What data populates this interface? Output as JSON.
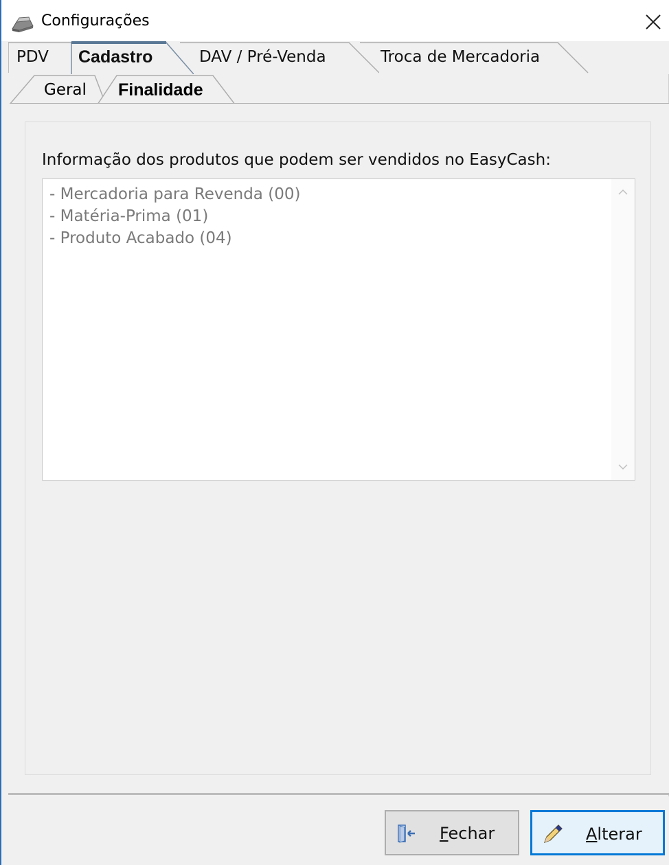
{
  "window": {
    "title": "Configurações",
    "title_icon": "cash-register-icon",
    "close_icon": "close-icon"
  },
  "tabs": [
    {
      "label": "PDV",
      "active": false
    },
    {
      "label": "Cadastro",
      "active": true
    },
    {
      "label": "DAV / Pré-Venda",
      "active": false
    },
    {
      "label": "Troca de Mercadoria",
      "active": false
    }
  ],
  "subtabs": [
    {
      "label": "Geral",
      "active": false
    },
    {
      "label": "Finalidade",
      "active": true
    }
  ],
  "content": {
    "group_label": "Informação dos produtos que podem ser vendidos no EasyCash:",
    "items": [
      "- Mercadoria para Revenda (00)",
      "- Matéria-Prima (01)",
      "- Produto Acabado (04)"
    ]
  },
  "buttons": {
    "fechar": {
      "label": "Fechar",
      "icon": "exit-door-icon"
    },
    "alterar": {
      "label": "Alterar",
      "icon": "pencil-icon"
    }
  },
  "colors": {
    "accent": "#0078d7",
    "window_border": "#2b6cb6",
    "list_text": "#7a7a7a"
  }
}
